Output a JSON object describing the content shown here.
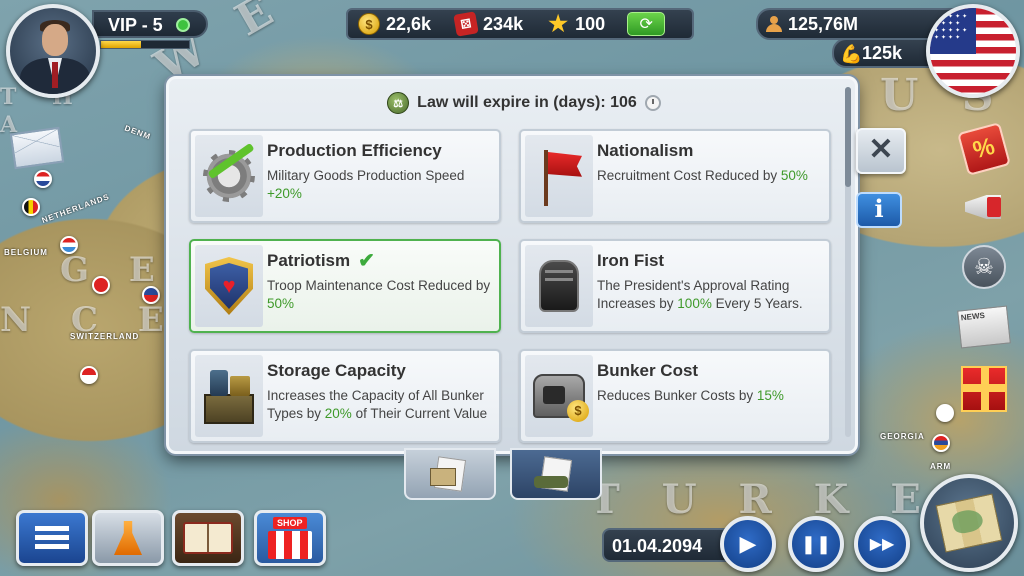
{
  "map": {
    "labels": [
      "W E",
      "G E R M",
      "N C E",
      "U S",
      "T U R K E Y",
      "T H",
      "A"
    ],
    "small_labels": [
      "NETHERLANDS",
      "BELGIUM",
      "SWITZERLAND",
      "DENM",
      "GEORGIA",
      "ARM"
    ]
  },
  "player": {
    "vip_label": "VIP - 5",
    "vip_progress": 0.45
  },
  "resources": {
    "money": "22,6k",
    "dice": "234k",
    "stars": "100",
    "population": "125,76M",
    "army": "125k"
  },
  "dialog": {
    "expire_text": "Law will expire in (days): 106",
    "laws": [
      {
        "title": "Production Efficiency",
        "desc_parts": [
          "Military Goods Production Speed ",
          "+20%",
          ""
        ],
        "icon": "gear-growth-icon",
        "active": false
      },
      {
        "title": "Nationalism",
        "desc_parts": [
          "Recruitment Cost Reduced by ",
          "50%",
          ""
        ],
        "icon": "red-flag-icon",
        "active": false
      },
      {
        "title": "Patriotism",
        "desc_parts": [
          "Troop Maintenance Cost Reduced by ",
          "50%",
          ""
        ],
        "icon": "heart-shield-icon",
        "active": true
      },
      {
        "title": "Iron Fist",
        "desc_parts": [
          "The President's Approval Rating Increases by ",
          "100%",
          " Every 5 Years."
        ],
        "icon": "iron-fist-icon",
        "active": false
      },
      {
        "title": "Storage Capacity",
        "desc_parts": [
          "Increases the Capacity of All Bunker Types by ",
          "20%",
          " of Their Current Value"
        ],
        "icon": "storage-crates-icon",
        "active": false
      },
      {
        "title": "Bunker Cost",
        "desc_parts": [
          "Reduces Bunker Costs by ",
          "15%",
          ""
        ],
        "icon": "bunker-coin-icon",
        "active": false
      }
    ]
  },
  "buttons": {
    "close": "✕",
    "info": "i",
    "play": "▶",
    "pause": "❚❚",
    "fast": "▶▶",
    "shop_sign": "SHOP",
    "news": "NEWS",
    "sale": "%"
  },
  "date": "01.04.2094",
  "colors": {
    "highlight_green": "#3f9a2a",
    "active_border": "#4fb24f",
    "hud_dark": "#1f2a36",
    "accent_blue": "#1b4590"
  }
}
